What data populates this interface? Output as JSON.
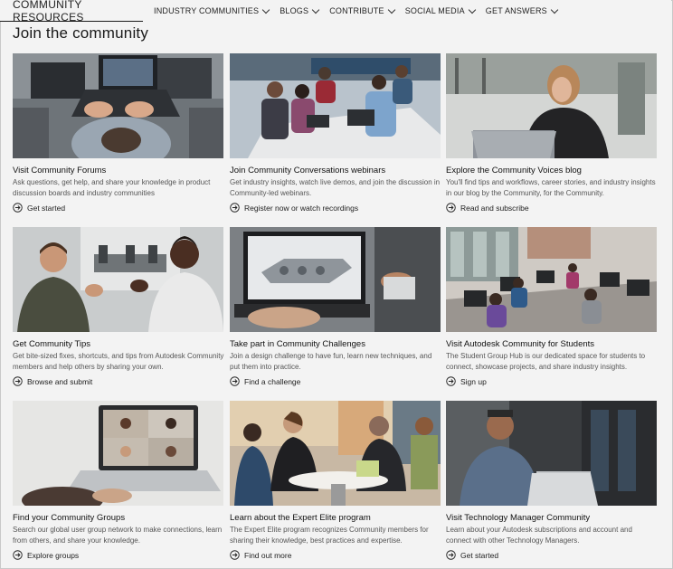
{
  "header": {
    "brand": "COMMUNITY RESOURCES",
    "menu": [
      {
        "label": "INDUSTRY COMMUNITIES"
      },
      {
        "label": "BLOGS"
      },
      {
        "label": "CONTRIBUTE"
      },
      {
        "label": "SOCIAL MEDIA"
      },
      {
        "label": "GET ANSWERS"
      }
    ]
  },
  "page": {
    "title": "Join the community"
  },
  "cards": [
    {
      "title": "Visit Community Forums",
      "desc": "Ask questions, get help, and share your knowledge in product discussion boards and industry communities",
      "link": "Get started"
    },
    {
      "title": "Join Community Conversations webinars",
      "desc": "Get industry insights, watch live demos, and join the discussion in Community-led webinars.",
      "link": "Register now or watch recordings"
    },
    {
      "title": "Explore the Community Voices blog",
      "desc": "You'll find tips and workflows, career stories, and industry insights in our blog by the Community, for the Community.",
      "link": "Read and subscribe"
    },
    {
      "title": "Get Community Tips",
      "desc": "Get bite-sized fixes, shortcuts, and tips from Autodesk Community members and help others by sharing your own.",
      "link": "Browse and submit"
    },
    {
      "title": "Take part in Community Challenges",
      "desc": "Join a design challenge to have fun, learn new techniques, and put them into practice.",
      "link": "Find a challenge"
    },
    {
      "title": "Visit Autodesk Community for Students",
      "desc": "The Student Group Hub is our dedicated space for students to connect, showcase projects, and share industry insights.",
      "link": "Sign up"
    },
    {
      "title": "Find your Community Groups",
      "desc": "Search our global user group network to make connections, learn from others, and share your knowledge.",
      "link": "Explore groups"
    },
    {
      "title": "Learn about the Expert Elite program",
      "desc": "The Expert Elite program recognizes Community members for sharing their knowledge, best practices and expertise.",
      "link": "Find out more"
    },
    {
      "title": "Visit Technology Manager Community",
      "desc": "Learn about your Autodesk subscriptions and account and connect with other Technology Managers.",
      "link": "Get started"
    }
  ]
}
